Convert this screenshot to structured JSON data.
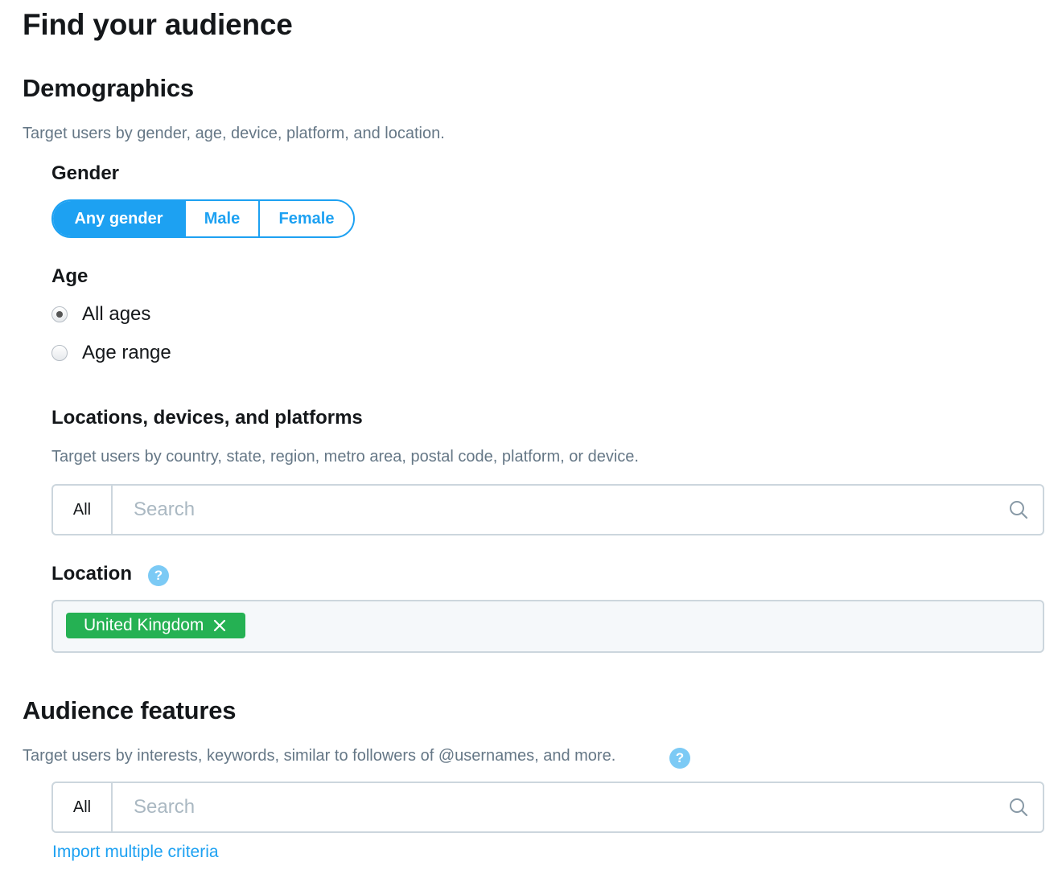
{
  "page": {
    "title": "Find your audience"
  },
  "demographics": {
    "heading": "Demographics",
    "description": "Target users by gender, age, device, platform, and location.",
    "gender": {
      "label": "Gender",
      "options": [
        "Any gender",
        "Male",
        "Female"
      ],
      "selected": "Any gender"
    },
    "age": {
      "label": "Age",
      "options": [
        "All ages",
        "Age range"
      ],
      "selected": "All ages"
    },
    "locations": {
      "heading": "Locations, devices, and platforms",
      "description": "Target users by country, state, region, metro area, postal code, platform, or device.",
      "search": {
        "prefix": "All",
        "placeholder": "Search"
      }
    },
    "location": {
      "label": "Location",
      "help": "?",
      "tags": [
        "United Kingdom"
      ]
    }
  },
  "audience_features": {
    "heading": "Audience features",
    "description": "Target users by interests, keywords, similar to followers of @usernames, and more.",
    "help": "?",
    "search": {
      "prefix": "All",
      "placeholder": "Search"
    },
    "import_link": "Import multiple criteria"
  },
  "colors": {
    "accent": "#1da1f2",
    "tag_green": "#25b153",
    "help_blue": "#7ccaf5",
    "muted_text": "#657786"
  },
  "icons": {
    "search": "search-icon",
    "help": "help-icon",
    "remove": "close-icon"
  }
}
